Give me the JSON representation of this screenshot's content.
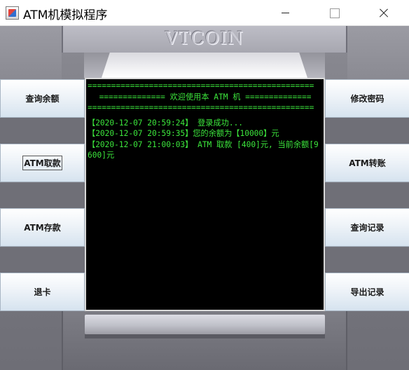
{
  "window": {
    "title": "ATM机模拟程序"
  },
  "machine": {
    "brand": "VTCOIN"
  },
  "buttons": {
    "left": [
      "查询余额",
      "ATM取款",
      "ATM存款",
      "退卡"
    ],
    "right": [
      "修改密码",
      "ATM转账",
      "查询记录",
      "导出记录"
    ]
  },
  "screen": {
    "separator": "================================================",
    "welcome": "============== 欢迎使用本 ATM 机 ==============",
    "log": [
      "【2020-12-07 20:59:24】 登录成功...",
      "【2020-12-07 20:59:35】您的余额为【10000】元",
      "【2020-12-07 21:00:03】 ATM 取款 [400]元, 当前余额[9600]元"
    ]
  },
  "colors": {
    "screen_background": "#000000",
    "screen_text": "#3ce63c"
  }
}
